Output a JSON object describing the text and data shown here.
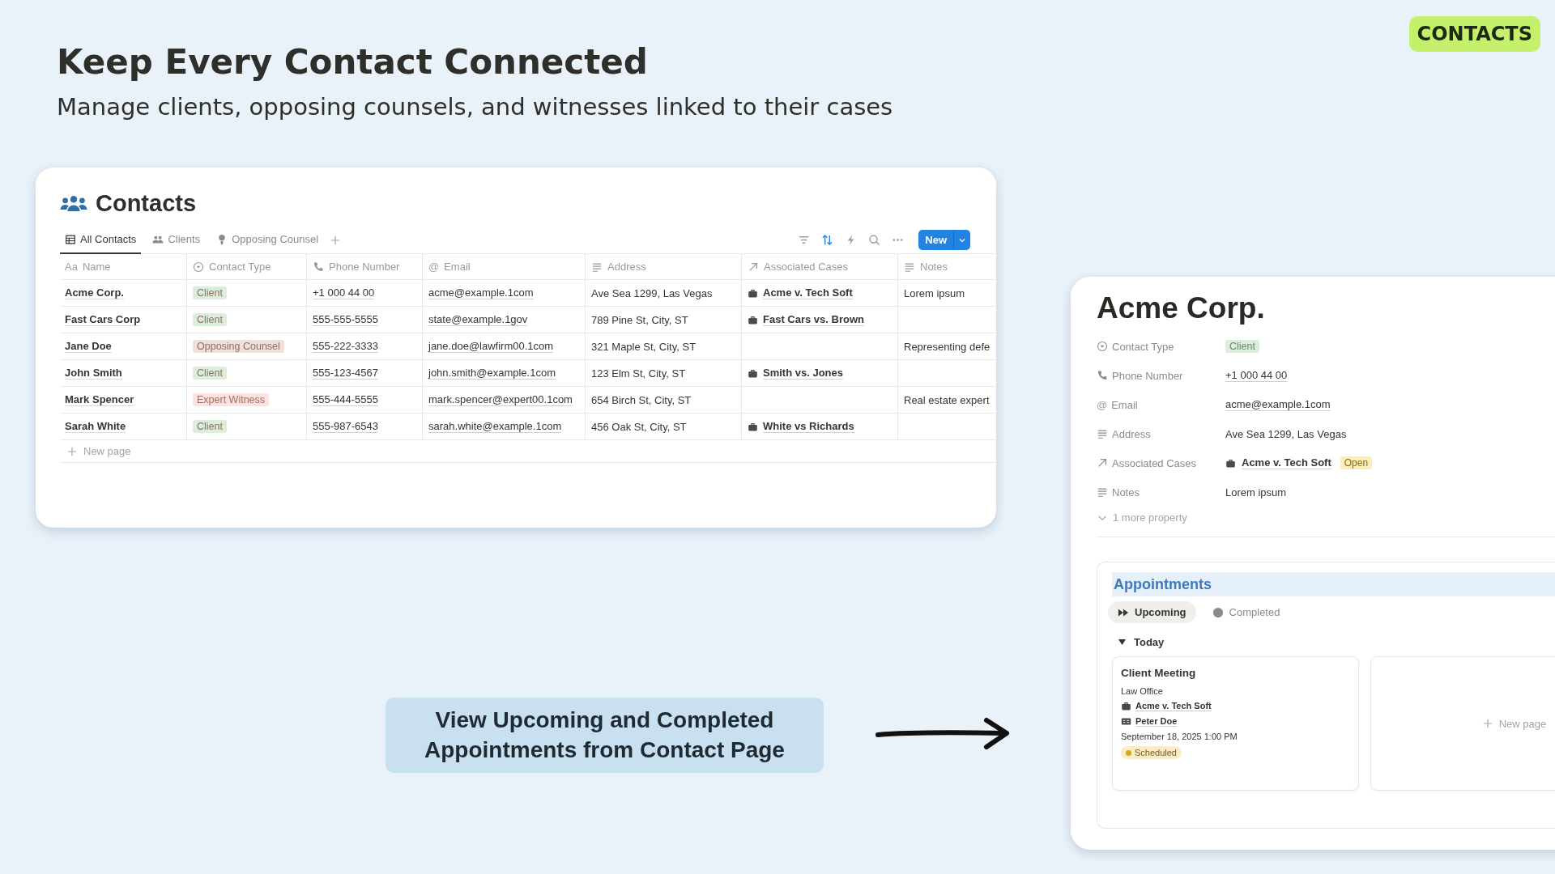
{
  "badge": "CONTACTS",
  "headline": "Keep Every Contact Connected",
  "subheadline": "Manage clients, opposing counsels, and witnesses linked to their cases",
  "database": {
    "title": "Contacts",
    "views": [
      {
        "label": "All Contacts",
        "selected": true
      },
      {
        "label": "Clients",
        "selected": false
      },
      {
        "label": "Opposing Counsel",
        "selected": false
      }
    ],
    "new_button": "New",
    "columns": [
      {
        "label": "Name",
        "kind": "title",
        "glyph": "Aa"
      },
      {
        "label": "Contact Type",
        "kind": "select"
      },
      {
        "label": "Phone Number",
        "kind": "phone"
      },
      {
        "label": "Email",
        "kind": "email",
        "glyph": "@"
      },
      {
        "label": "Address",
        "kind": "text"
      },
      {
        "label": "Associated Cases",
        "kind": "relation"
      },
      {
        "label": "Notes",
        "kind": "text"
      }
    ],
    "rows": [
      {
        "name": "Acme Corp.",
        "type": {
          "label": "Client",
          "color": "#dbeddb"
        },
        "phone": "+1 000 44 00",
        "email": "acme@example.1com",
        "address": "Ave Sea 1299, Las Vegas",
        "case": "Acme v. Tech Soft",
        "notes": "Lorem ipsum"
      },
      {
        "name": "Fast Cars Corp",
        "type": {
          "label": "Client",
          "color": "#dbeddb"
        },
        "phone": "555-555-5555",
        "email": "state@example.1gov",
        "address": "789 Pine St, City, ST",
        "case": "Fast Cars vs. Brown"
      },
      {
        "name": "Jane Doe",
        "type": {
          "label": "Opposing Counsel",
          "color": "#eee0da"
        },
        "phone": "555-222-3333",
        "email": "jane.doe@lawfirm00.1com",
        "address": "321 Maple St, City, ST",
        "notes": "Representing defe"
      },
      {
        "name": "John Smith",
        "type": {
          "label": "Client",
          "color": "#dbeddb"
        },
        "phone": "555-123-4567",
        "email": "john.smith@example.1com",
        "address": "123 Elm St, City, ST",
        "case": "Smith vs. Jones"
      },
      {
        "name": "Mark Spencer",
        "type": {
          "label": "Expert Witness",
          "color": "#ffe2dd"
        },
        "phone": "555-444-5555",
        "email": "mark.spencer@expert00.1com",
        "address": "654 Birch St, City, ST",
        "notes": "Real estate expert"
      },
      {
        "name": "Sarah White",
        "type": {
          "label": "Client",
          "color": "#dbeddb"
        },
        "phone": "555-987-6543",
        "email": "sarah.white@example.1com",
        "address": "456 Oak St, City, ST",
        "case": "White vs Richards"
      }
    ],
    "new_row": "New page"
  },
  "callout": "View Upcoming and Completed\nAppointments from Contact Page",
  "contact_page": {
    "title": "Acme Corp.",
    "properties": [
      {
        "label": "Contact Type",
        "kind": "tag",
        "value": "Client",
        "color": "#dbeddb"
      },
      {
        "label": "Phone Number",
        "kind": "link",
        "value": "+1 000 44 00"
      },
      {
        "label": "Email",
        "glyph": "@",
        "kind": "link",
        "value": "acme@example.1com"
      },
      {
        "label": "Address",
        "kind": "text",
        "value": "Ave Sea 1299, Las Vegas"
      },
      {
        "label": "Associated Cases",
        "kind": "case",
        "value": "Acme v. Tech Soft",
        "status": "Open"
      },
      {
        "label": "Notes",
        "kind": "text",
        "value": "Lorem ipsum"
      }
    ],
    "more": "1 more property",
    "appointments": {
      "title": "Appointments",
      "views": [
        {
          "label": "Upcoming",
          "selected": true
        },
        {
          "label": "Completed",
          "selected": false
        }
      ],
      "group": {
        "label": "Today",
        "expanded": true
      },
      "cards": [
        {
          "title": "Client Meeting",
          "location": "Law Office",
          "case": "Acme v. Tech Soft",
          "person": "Peter Doe",
          "date": "September 18, 2025 1:00 PM",
          "status": {
            "label": "Scheduled",
            "color": "#d9a521"
          }
        }
      ],
      "new_card": "New page"
    }
  }
}
